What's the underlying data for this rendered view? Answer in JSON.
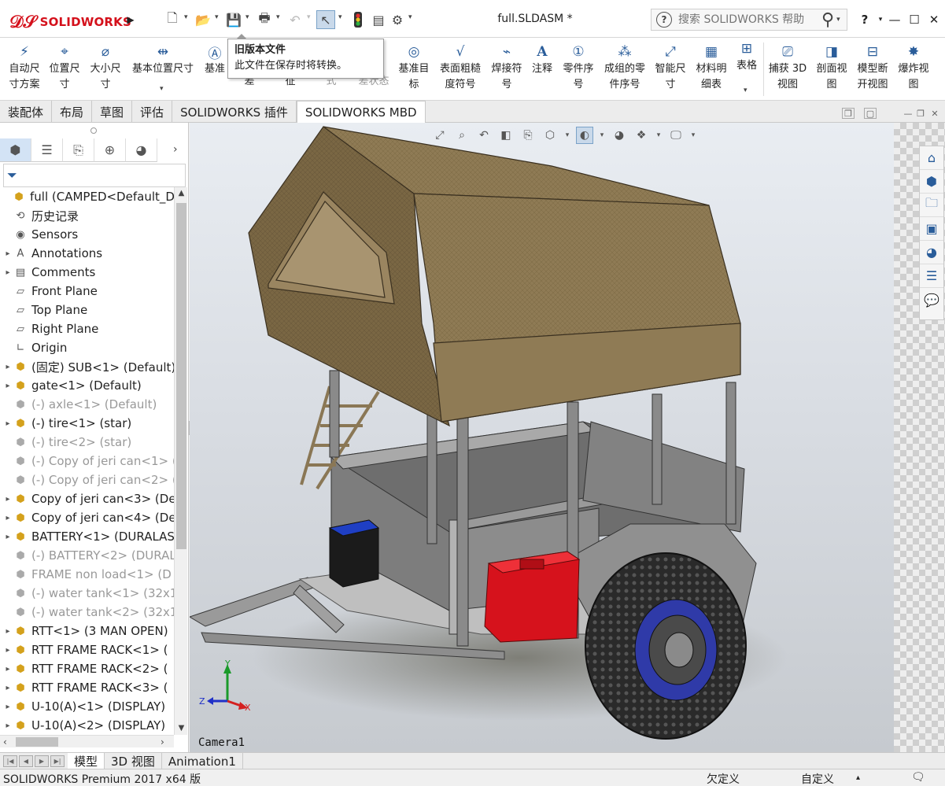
{
  "app": {
    "logo_text": "SOLIDWORKS",
    "document_title": "full.SLDASM *",
    "help_search_placeholder": "搜索 SOLIDWORKS 帮助"
  },
  "tooltip": {
    "title": "旧版本文件",
    "body": "此文件在保存时将转换。"
  },
  "ribbon": {
    "commands": [
      {
        "label": "自动尺\n寸方案",
        "icon": "auto-dimension-icon"
      },
      {
        "label": "位置尺\n寸",
        "icon": "location-dimension-icon"
      },
      {
        "label": "大小尺\n寸",
        "icon": "size-dimension-icon"
      },
      {
        "label": "基本位置尺寸",
        "icon": "basic-location-dimension-icon"
      },
      {
        "label": "基准",
        "icon": "datum-icon"
      },
      {
        "label": "差",
        "icon": "tolerance-icon"
      },
      {
        "label": "征",
        "icon": "feature-icon"
      },
      {
        "label": "式",
        "icon": "pattern-icon"
      },
      {
        "label": "差状态",
        "icon": "tolerance-status-icon"
      },
      {
        "label": "基准目\n标",
        "icon": "datum-target-icon"
      },
      {
        "label": "表面粗糙\n度符号",
        "icon": "surface-finish-icon"
      },
      {
        "label": "焊接符\n号",
        "icon": "weld-symbol-icon"
      },
      {
        "label": "注释",
        "icon": "note-icon"
      },
      {
        "label": "零件序\n号",
        "icon": "balloon-icon"
      },
      {
        "label": "成组的零\n件序号",
        "icon": "stacked-balloon-icon"
      },
      {
        "label": "智能尺\n寸",
        "icon": "smart-dimension-icon"
      },
      {
        "label": "材料明\n细表",
        "icon": "bom-icon"
      },
      {
        "label": "表格",
        "icon": "table-icon"
      },
      {
        "label": "捕获 3D\n视图",
        "icon": "capture-3d-view-icon"
      },
      {
        "label": "剖面视\n图",
        "icon": "section-view-icon"
      },
      {
        "label": "模型断\n开视图",
        "icon": "break-view-icon"
      },
      {
        "label": "爆炸视\n图",
        "icon": "exploded-view-icon"
      }
    ]
  },
  "command_tabs": [
    "装配体",
    "布局",
    "草图",
    "评估",
    "SOLIDWORKS 插件",
    "SOLIDWORKS MBD"
  ],
  "active_command_tab": "SOLIDWORKS MBD",
  "feature_tree": [
    {
      "label": "full  (CAMPED<Default_Disp",
      "expand": "",
      "icon": "assembly-icon",
      "suppressed": false
    },
    {
      "label": "历史记录",
      "expand": "",
      "icon": "history-icon",
      "suppressed": false
    },
    {
      "label": "Sensors",
      "expand": "",
      "icon": "sensor-icon",
      "suppressed": false
    },
    {
      "label": "Annotations",
      "expand": "▸",
      "icon": "annotations-icon",
      "suppressed": false
    },
    {
      "label": "Comments",
      "expand": "▸",
      "icon": "comments-icon",
      "suppressed": false
    },
    {
      "label": "Front Plane",
      "expand": "",
      "icon": "plane-icon",
      "suppressed": false
    },
    {
      "label": "Top Plane",
      "expand": "",
      "icon": "plane-icon",
      "suppressed": false
    },
    {
      "label": "Right Plane",
      "expand": "",
      "icon": "plane-icon",
      "suppressed": false
    },
    {
      "label": "Origin",
      "expand": "",
      "icon": "origin-icon",
      "suppressed": false
    },
    {
      "label": "(固定) SUB<1> (Default)",
      "expand": "▸",
      "icon": "assembly-icon",
      "suppressed": false
    },
    {
      "label": "gate<1> (Default)",
      "expand": "▸",
      "icon": "assembly-icon",
      "suppressed": false
    },
    {
      "label": "(-) axle<1> (Default)",
      "expand": "",
      "icon": "part-icon",
      "suppressed": true
    },
    {
      "label": "(-) tire<1> (star)",
      "expand": "▸",
      "icon": "assembly-icon",
      "suppressed": false
    },
    {
      "label": "(-) tire<2> (star)",
      "expand": "",
      "icon": "part-icon",
      "suppressed": true
    },
    {
      "label": "(-) Copy of jeri can<1> (",
      "expand": "",
      "icon": "part-icon",
      "suppressed": true
    },
    {
      "label": "(-) Copy of jeri can<2> (",
      "expand": "",
      "icon": "part-icon",
      "suppressed": true
    },
    {
      "label": "Copy of jeri can<3> (De",
      "expand": "▸",
      "icon": "assembly-icon",
      "suppressed": false
    },
    {
      "label": "Copy of jeri can<4> (De",
      "expand": "▸",
      "icon": "assembly-icon",
      "suppressed": false
    },
    {
      "label": "BATTERY<1> (DURALAS",
      "expand": "▸",
      "icon": "assembly-icon",
      "suppressed": false
    },
    {
      "label": "(-) BATTERY<2> (DURAL",
      "expand": "",
      "icon": "part-icon",
      "suppressed": true
    },
    {
      "label": "FRAME non load<1> (D",
      "expand": "",
      "icon": "part-icon",
      "suppressed": true
    },
    {
      "label": "(-) water tank<1> (32x1",
      "expand": "",
      "icon": "part-icon",
      "suppressed": true
    },
    {
      "label": "(-) water tank<2> (32x1",
      "expand": "",
      "icon": "part-icon",
      "suppressed": true
    },
    {
      "label": "RTT<1> (3 MAN OPEN)",
      "expand": "▸",
      "icon": "assembly-icon",
      "suppressed": false
    },
    {
      "label": "RTT FRAME RACK<1> (",
      "expand": "▸",
      "icon": "assembly-icon",
      "suppressed": false
    },
    {
      "label": "RTT FRAME RACK<2> (",
      "expand": "▸",
      "icon": "assembly-icon",
      "suppressed": false
    },
    {
      "label": "RTT FRAME RACK<3> (",
      "expand": "▸",
      "icon": "assembly-icon",
      "suppressed": false
    },
    {
      "label": "U-10(A)<1> (DISPLAY)",
      "expand": "▸",
      "icon": "assembly-icon",
      "suppressed": false
    },
    {
      "label": "U-10(A)<2> (DISPLAY)",
      "expand": "▸",
      "icon": "assembly-icon",
      "suppressed": false
    }
  ],
  "viewport": {
    "camera_label": "Camera1",
    "triad": {
      "x": "X",
      "y": "Y",
      "z": "Z"
    }
  },
  "bottom_tabs": [
    "模型",
    "3D 视图",
    "Animation1"
  ],
  "active_bottom_tab": "模型",
  "status": {
    "product": "SOLIDWORKS Premium 2017 x64 版",
    "definition": "欠定义",
    "units": "自定义"
  },
  "colors": {
    "brand_red": "#d4101b",
    "tent": "#8a7450",
    "jerry_can": "#d6121c",
    "battery": "#1f3fc4",
    "wheel_rim": "#2f3aa8"
  }
}
